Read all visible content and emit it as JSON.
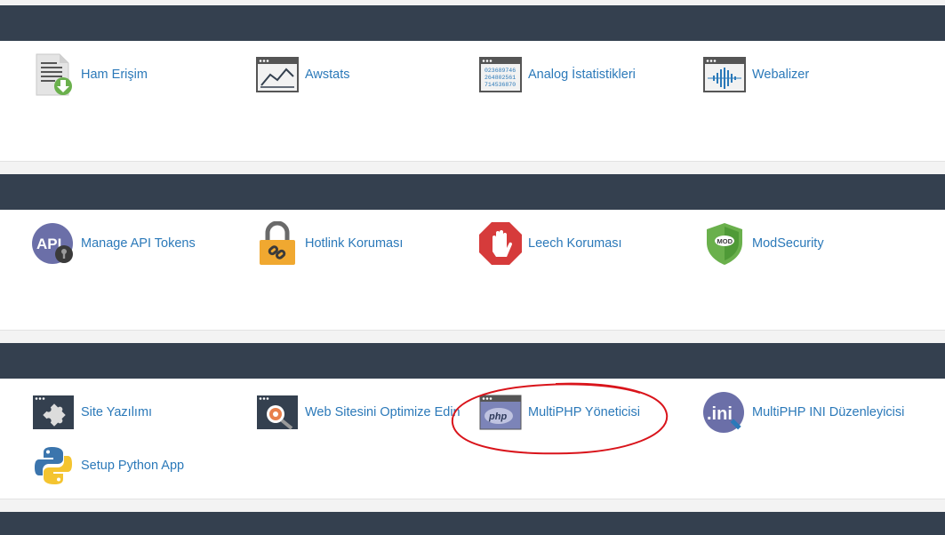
{
  "sections": [
    {
      "items": [
        {
          "label": "Ham Erişim",
          "icon": "raw-access-icon"
        },
        {
          "label": "Awstats",
          "icon": "awstats-icon"
        },
        {
          "label": "Analog İstatistikleri",
          "icon": "analog-stats-icon"
        },
        {
          "label": "Webalizer",
          "icon": "webalizer-icon"
        }
      ]
    },
    {
      "items": [
        {
          "label": "Manage API Tokens",
          "icon": "api-tokens-icon"
        },
        {
          "label": "Hotlink Koruması",
          "icon": "hotlink-lock-icon"
        },
        {
          "label": "Leech Koruması",
          "icon": "leech-hand-icon"
        },
        {
          "label": "ModSecurity",
          "icon": "modsecurity-shield-icon"
        }
      ]
    },
    {
      "items": [
        {
          "label": "Site Yazılımı",
          "icon": "site-software-icon"
        },
        {
          "label": "Web Sitesini Optimize Edin",
          "icon": "optimize-website-icon"
        },
        {
          "label": "MultiPHP Yöneticisi",
          "icon": "multiphp-manager-icon"
        },
        {
          "label": "MultiPHP INI Düzenleyicisi",
          "icon": "multiphp-ini-icon"
        },
        {
          "label": "Setup Python App",
          "icon": "python-icon"
        }
      ]
    }
  ],
  "icon_text": {
    "api": "API",
    "mod": "MOD",
    "php": "php",
    "ini": ".ini",
    "analog_digits": [
      "023689746",
      "264802561",
      "714536870"
    ]
  },
  "colors": {
    "header_band": "#34404f",
    "link": "#2b79b9",
    "annotation": "#d9141b"
  }
}
